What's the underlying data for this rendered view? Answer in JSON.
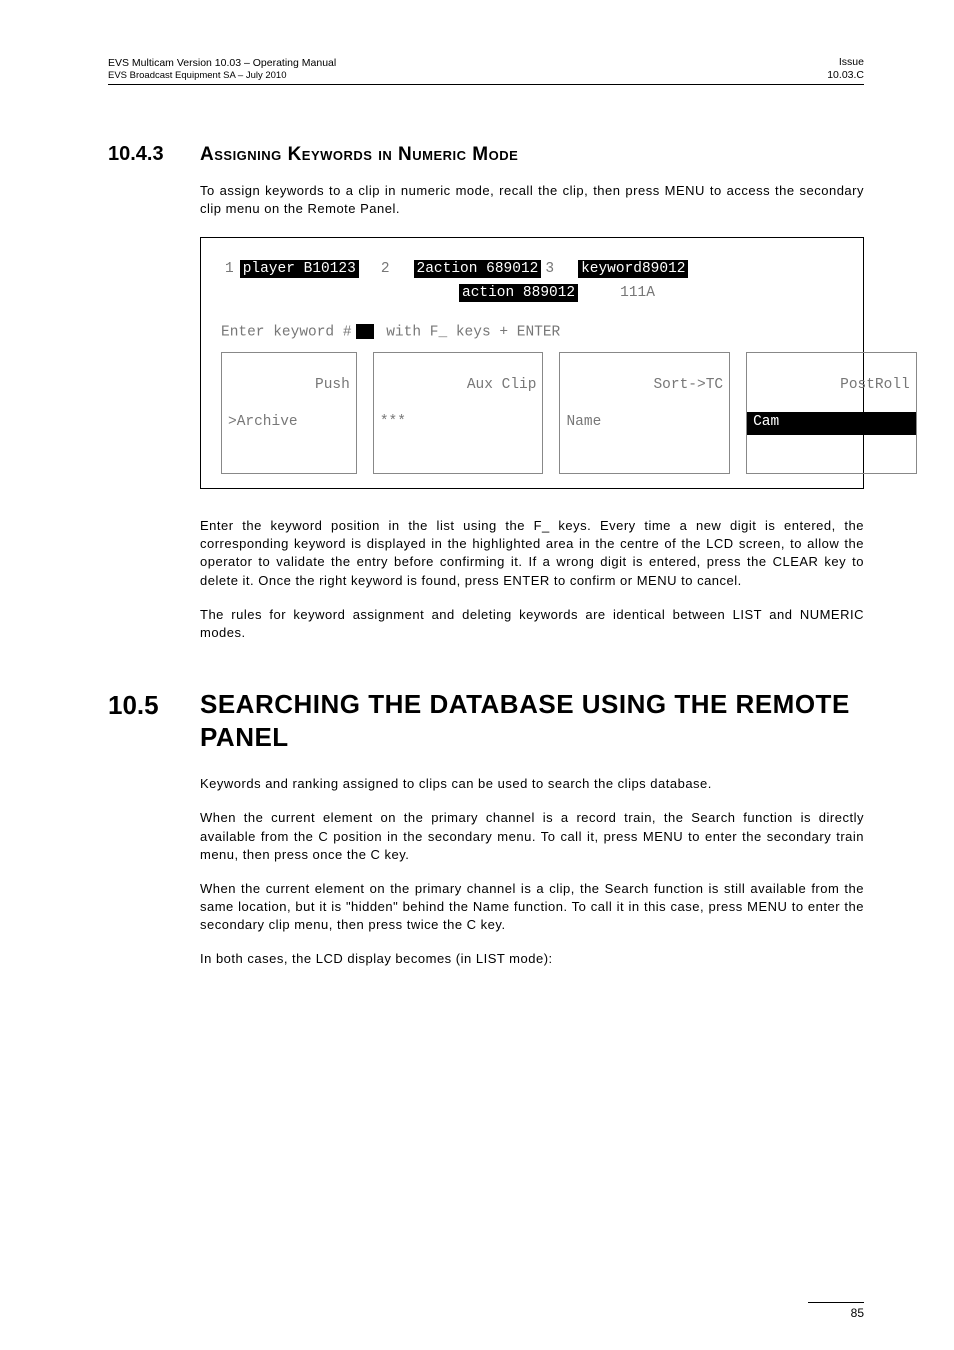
{
  "header": {
    "left_line1": "EVS Multicam Version 10.03  – Operating Manual",
    "left_line2": "EVS Broadcast Equipment SA – July 2010",
    "right_line1": "Issue",
    "right_line2": "10.03.C"
  },
  "sec1": {
    "num": "10.4.3",
    "title": "Assigning Keywords in Numeric Mode",
    "intro": "To assign keywords to a clip in numeric mode, recall the clip, then press MENU to access the secondary clip menu on the Remote Panel."
  },
  "lcd": {
    "n1": "1",
    "t1": "player B10123",
    "n2": "2",
    "t2": "2action 689012",
    "n3": "3",
    "t3": "keyword89012",
    "mid_tag": "action 889012",
    "mid_plain": "111A",
    "enter_pre": "Enter keyword #",
    "enter_post": " with F_ keys + ENTER",
    "btn1a": "Push",
    "btn1b": ">Archive",
    "btn2a": "Aux Clip",
    "btn2b": "***",
    "btn3a": "Sort->TC",
    "btn3b": "Name",
    "btn4a": "PostRoll",
    "btn4b": "Cam"
  },
  "para_after_lcd_1": "Enter the keyword position in the list using the F_ keys. Every time a new digit is entered, the corresponding keyword is displayed in the highlighted area in the centre of the LCD screen, to allow the operator to validate the entry before confirming it. If a wrong digit is entered, press the CLEAR key to delete it. Once the right keyword is found, press ENTER to confirm or MENU to cancel.",
  "para_after_lcd_2": "The rules for keyword assignment and deleting keywords are identical between LIST and NUMERIC modes.",
  "sec2": {
    "num": "10.5",
    "title": "SEARCHING THE DATABASE USING THE REMOTE PANEL",
    "p1": "Keywords and ranking assigned to clips can be used to search the clips database.",
    "p2": "When the current element on the primary channel is a record train, the Search function is directly available from the C position in the secondary menu. To call it, press MENU to enter the secondary train menu, then press once the C key.",
    "p3": "When the current element on the primary channel is a clip, the Search function is still available from the same location, but it is \"hidden\" behind the Name function. To call it in this case, press MENU to enter the secondary clip menu, then press twice the C key.",
    "p4": "In both cases, the LCD display becomes (in LIST mode):"
  },
  "page_number": "85"
}
